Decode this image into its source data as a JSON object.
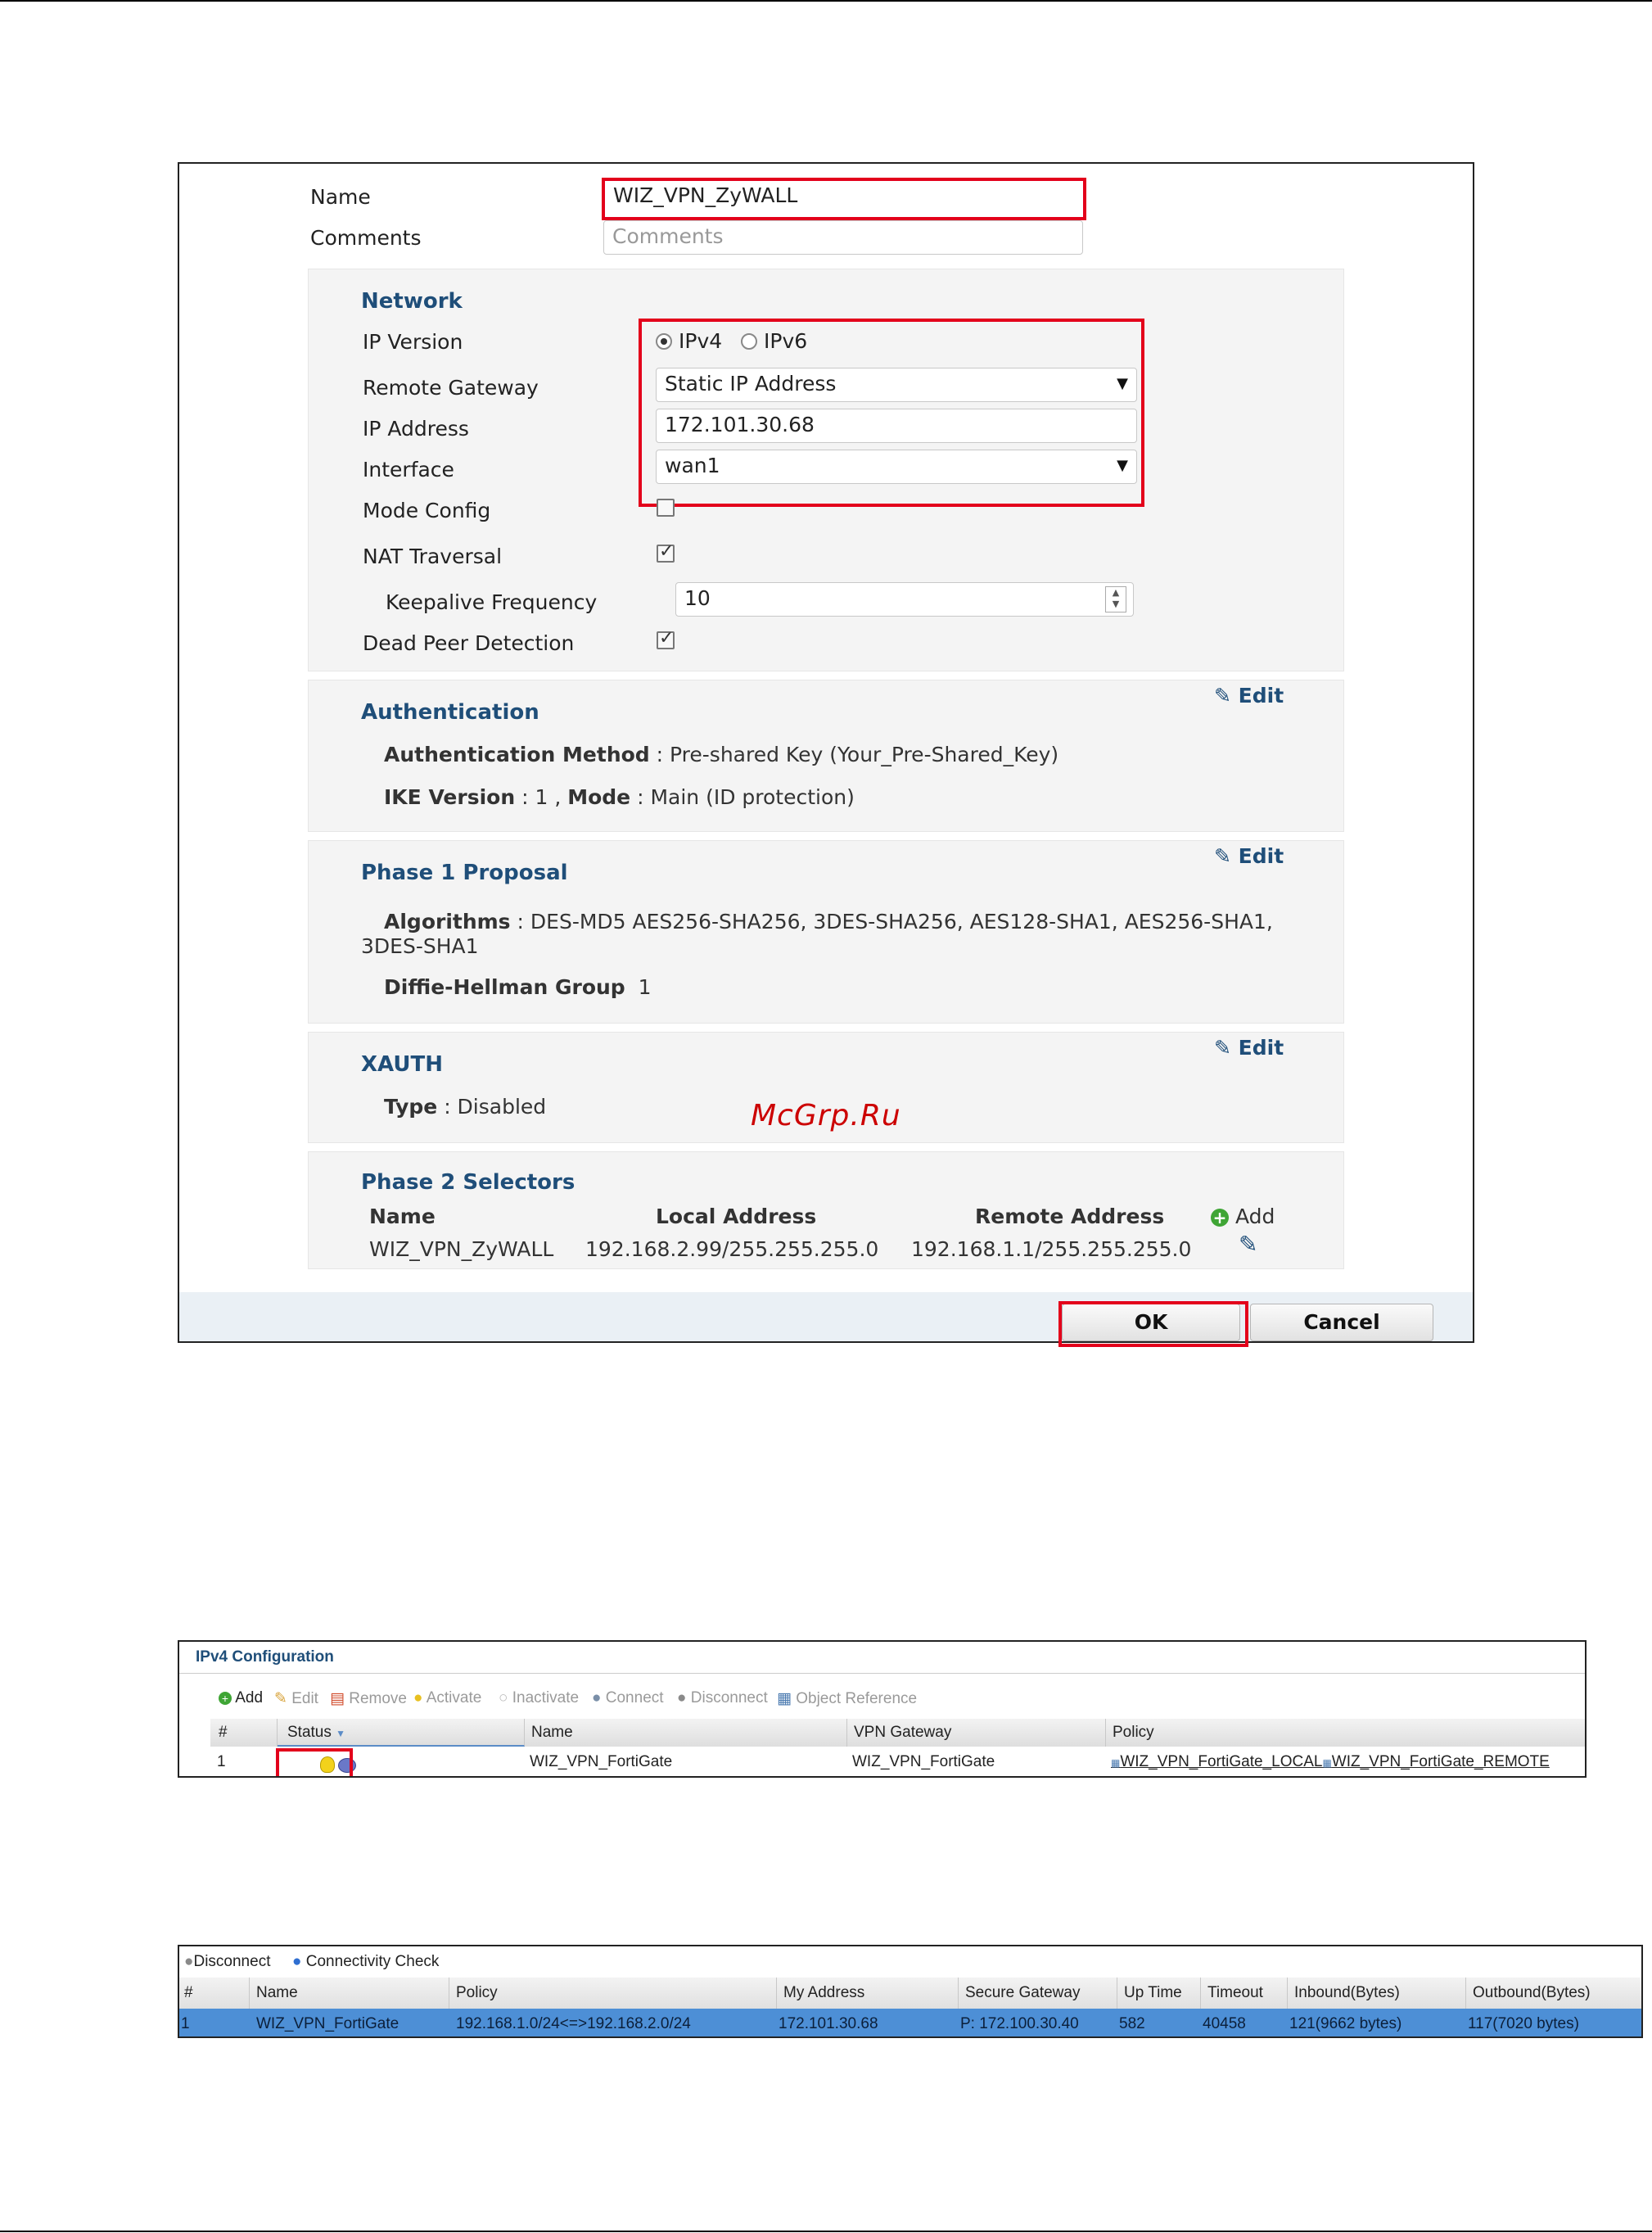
{
  "watermark": "McGrp.Ru",
  "panel1": {
    "name_label": "Name",
    "name_value": "WIZ_VPN_ZyWALL",
    "comments_label": "Comments",
    "comments_placeholder": "Comments",
    "network": {
      "title": "Network",
      "ip_version_label": "IP Version",
      "ipv4": "IPv4",
      "ipv6": "IPv6",
      "ip_version_selected": "IPv4",
      "remote_gateway_label": "Remote Gateway",
      "remote_gateway_value": "Static IP Address",
      "ip_address_label": "IP Address",
      "ip_address_value": "172.101.30.68",
      "interface_label": "Interface",
      "interface_value": "wan1",
      "mode_config_label": "Mode Config",
      "mode_config_checked": false,
      "nat_traversal_label": "NAT Traversal",
      "nat_traversal_checked": true,
      "keepalive_label": "Keepalive Frequency",
      "keepalive_value": "10",
      "dpd_label": "Dead Peer Detection",
      "dpd_checked": true
    },
    "authentication": {
      "title": "Authentication",
      "edit": "Edit",
      "method_label": "Authentication Method",
      "method_value": ": Pre-shared Key (Your_Pre-Shared_Key)",
      "ike_label": "IKE Version",
      "ike_value": ": 1 ,",
      "mode_label": "Mode",
      "mode_value": ": Main (ID protection)"
    },
    "phase1": {
      "title": "Phase 1 Proposal",
      "edit": "Edit",
      "algorithms_label": "Algorithms",
      "algorithms_value": ": DES-MD5  AES256-SHA256, 3DES-SHA256, AES128-SHA1, AES256-SHA1,",
      "algorithms_value_2": "3DES-SHA1",
      "dh_label": "Diffie-Hellman Group",
      "dh_value": "1"
    },
    "xauth": {
      "title": "XAUTH",
      "edit": "Edit",
      "type_label": "Type",
      "type_value": ": Disabled"
    },
    "phase2": {
      "title": "Phase 2 Selectors",
      "add": "Add",
      "columns": [
        "Name",
        "Local Address",
        "Remote Address"
      ],
      "rows": [
        {
          "name": "WIZ_VPN_ZyWALL",
          "local": "192.168.2.99/255.255.255.0",
          "remote": "192.168.1.1/255.255.255.0"
        }
      ]
    },
    "ok": "OK",
    "cancel": "Cancel"
  },
  "panel2": {
    "title": "IPv4 Configuration",
    "toolbar": [
      "Add",
      "Edit",
      "Remove",
      "Activate",
      "Inactivate",
      "Connect",
      "Disconnect",
      "Object Reference"
    ],
    "columns": [
      "#",
      "Status",
      "Name",
      "VPN Gateway",
      "Policy"
    ],
    "rows": [
      {
        "num": "1",
        "name": "WIZ_VPN_FortiGate",
        "gateway": "WIZ_VPN_FortiGate",
        "policy_local": "WIZ_VPN_FortiGate_LOCAL",
        "policy_remote": "WIZ_VPN_FortiGate_REMOTE"
      }
    ]
  },
  "panel3": {
    "toolbar": [
      "Disconnect",
      "Connectivity Check"
    ],
    "columns": [
      "#",
      "Name",
      "Policy",
      "My Address",
      "Secure Gateway",
      "Up Time",
      "Timeout",
      "Inbound(Bytes)",
      "Outbound(Bytes)"
    ],
    "rows": [
      {
        "num": "1",
        "name": "WIZ_VPN_FortiGate",
        "policy": "192.168.1.0/24<=>192.168.2.0/24",
        "my_address": "172.101.30.68",
        "secure_gateway": "P: 172.100.30.40",
        "uptime": "582",
        "timeout": "40458",
        "inbound": "121(9662 bytes)",
        "outbound": "117(7020 bytes)"
      }
    ]
  },
  "colors": {
    "highlight": "#e3001b",
    "section_title": "#1f4e79",
    "selected_row": "#4d8fd6"
  }
}
